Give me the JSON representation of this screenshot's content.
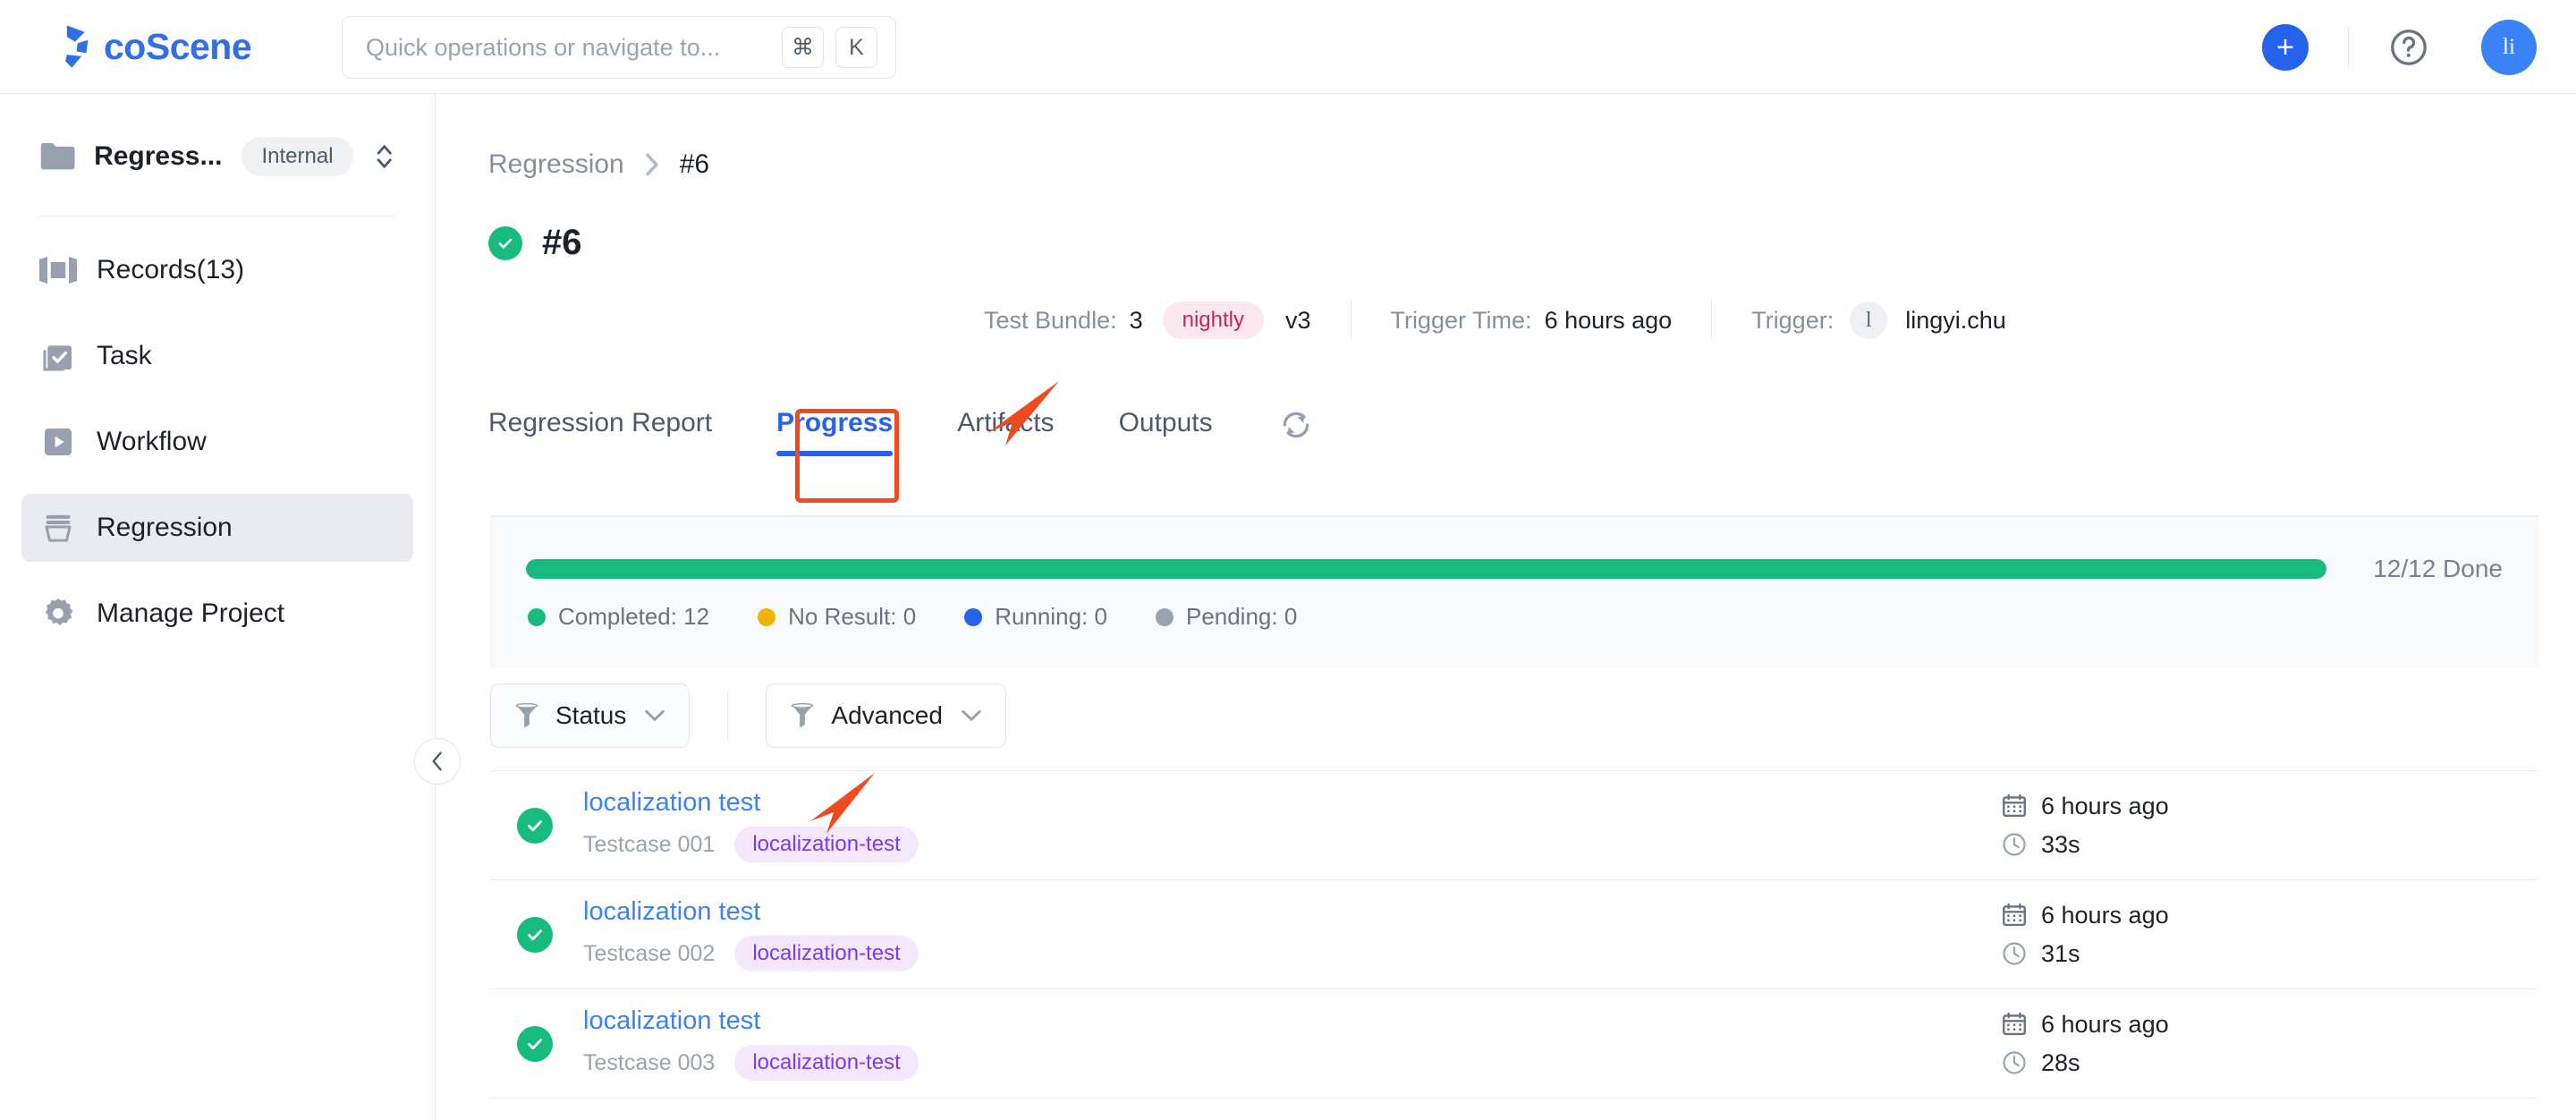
{
  "brand": {
    "name": "coScene",
    "color": "#2f6fe8"
  },
  "search": {
    "placeholder": "Quick operations or navigate to...",
    "value": "",
    "kbd_mod": "⌘",
    "kbd_key": "K"
  },
  "header": {
    "add_label": "+",
    "avatar_initials": "li"
  },
  "sidebar": {
    "project": {
      "name": "Regress...",
      "badge": "Internal"
    },
    "items": [
      {
        "label": "Records(13)",
        "icon": "records-icon",
        "active": false
      },
      {
        "label": "Task",
        "icon": "task-icon",
        "active": false
      },
      {
        "label": "Workflow",
        "icon": "workflow-icon",
        "active": false
      },
      {
        "label": "Regression",
        "icon": "regression-icon",
        "active": true
      },
      {
        "label": "Manage Project",
        "icon": "gear-icon",
        "active": false
      }
    ]
  },
  "breadcrumb": {
    "parent": "Regression",
    "current": "#6"
  },
  "page": {
    "title": "#6",
    "status": "success"
  },
  "meta": {
    "test_bundle_label": "Test Bundle:",
    "test_bundle_value": "3",
    "test_bundle_tag": "nightly",
    "test_bundle_version": "v3",
    "trigger_time_label": "Trigger Time:",
    "trigger_time_value": "6 hours ago",
    "trigger_label": "Trigger:",
    "trigger_avatar": "l",
    "trigger_user": "lingyi.chu"
  },
  "tabs": [
    {
      "label": "Regression Report",
      "active": false
    },
    {
      "label": "Progress",
      "active": true
    },
    {
      "label": "Artifacts",
      "active": false
    },
    {
      "label": "Outputs",
      "active": false
    }
  ],
  "progress": {
    "percent": 100,
    "caption": "12/12 Done",
    "bar_color": "#18bb7e",
    "legend": [
      {
        "label": "Completed: 12",
        "color": "#18bb7e"
      },
      {
        "label": "No Result: 0",
        "color": "#f0b400"
      },
      {
        "label": "Running: 0",
        "color": "#2563eb"
      },
      {
        "label": "Pending: 0",
        "color": "#9aa3b0"
      }
    ]
  },
  "filters": [
    {
      "label": "Status",
      "icon": "filter-icon"
    },
    {
      "label": "Advanced",
      "icon": "filter-icon"
    }
  ],
  "rows": [
    {
      "status": "success",
      "title": "localization test",
      "case": "Testcase 001",
      "tag": "localization-test",
      "time": "6 hours ago",
      "duration": "33s"
    },
    {
      "status": "success",
      "title": "localization test",
      "case": "Testcase 002",
      "tag": "localization-test",
      "time": "6 hours ago",
      "duration": "31s"
    },
    {
      "status": "success",
      "title": "localization test",
      "case": "Testcase 003",
      "tag": "localization-test",
      "time": "6 hours ago",
      "duration": "28s"
    }
  ],
  "colors": {
    "accent_blue": "#2563eb",
    "success_green": "#18bb7e",
    "annotation_red": "#f04a23",
    "tag_purple": "#7c3aed",
    "tag_pink": "#c4255b"
  }
}
